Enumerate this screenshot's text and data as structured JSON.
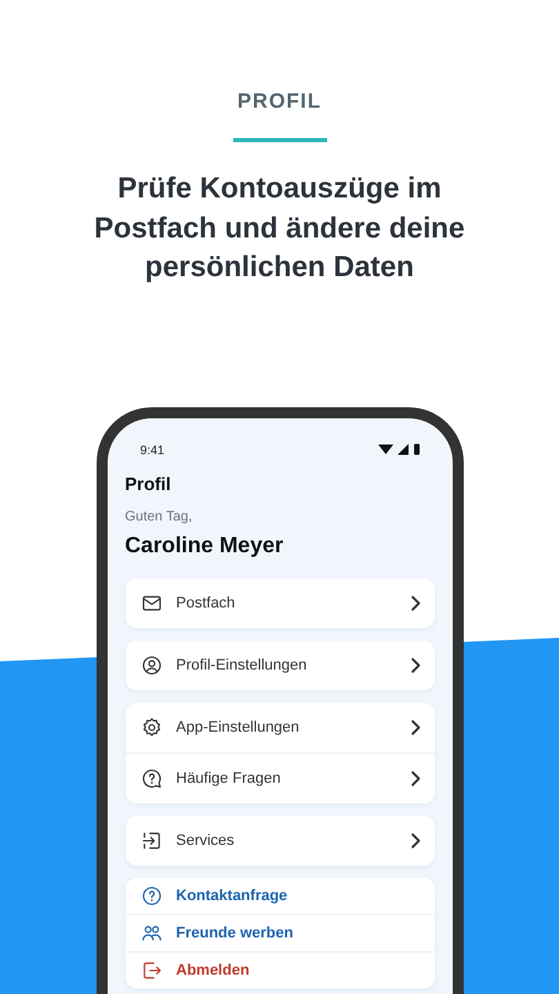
{
  "header": {
    "eyebrow": "PROFIL",
    "headline": "Prüfe Kontoauszüge im Postfach und ändere deine persönlichen Daten"
  },
  "phone": {
    "status_bar": {
      "time": "9:41"
    },
    "title": "Profil",
    "greeting": "Guten Tag,",
    "user_name": "Caroline Meyer",
    "groups": [
      {
        "kind": "nav",
        "items": [
          {
            "label": "Postfach"
          }
        ]
      },
      {
        "kind": "nav",
        "items": [
          {
            "label": "Profil-Einstellungen"
          }
        ]
      },
      {
        "kind": "nav",
        "items": [
          {
            "label": "App-Einstellungen"
          },
          {
            "label": "Häufige Fragen"
          }
        ]
      },
      {
        "kind": "nav",
        "items": [
          {
            "label": "Services"
          }
        ]
      },
      {
        "kind": "action",
        "items": [
          {
            "label": "Kontaktanfrage",
            "color": "#1c64b0"
          },
          {
            "label": "Freunde werben",
            "color": "#1c64b0"
          },
          {
            "label": "Abmelden",
            "color": "#c0392b"
          }
        ]
      }
    ]
  }
}
